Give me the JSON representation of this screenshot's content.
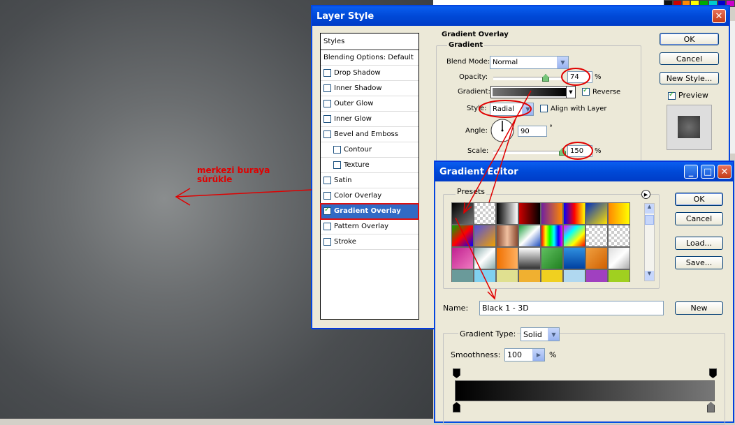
{
  "annotation": {
    "line1": "merkezi buraya",
    "line2": "sürükle"
  },
  "layer_style": {
    "title": "Layer Style",
    "styles_header": "Styles",
    "items": [
      {
        "label": "Blending Options: Default",
        "checkbox": false,
        "checked": false
      },
      {
        "label": "Drop Shadow",
        "checkbox": true,
        "checked": false
      },
      {
        "label": "Inner Shadow",
        "checkbox": true,
        "checked": false
      },
      {
        "label": "Outer Glow",
        "checkbox": true,
        "checked": false
      },
      {
        "label": "Inner Glow",
        "checkbox": true,
        "checked": false
      },
      {
        "label": "Bevel and Emboss",
        "checkbox": true,
        "checked": false
      },
      {
        "label": "Contour",
        "checkbox": true,
        "checked": false
      },
      {
        "label": "Texture",
        "checkbox": true,
        "checked": false
      },
      {
        "label": "Satin",
        "checkbox": true,
        "checked": false
      },
      {
        "label": "Color Overlay",
        "checkbox": true,
        "checked": false
      },
      {
        "label": "Gradient Overlay",
        "checkbox": true,
        "checked": true
      },
      {
        "label": "Pattern Overlay",
        "checkbox": true,
        "checked": false
      },
      {
        "label": "Stroke",
        "checkbox": true,
        "checked": false
      }
    ],
    "section_title": "Gradient Overlay",
    "group_title": "Gradient",
    "blend_mode_label": "Blend Mode:",
    "blend_mode_value": "Normal",
    "opacity_label": "Opacity:",
    "opacity_value": "74",
    "opacity_level": 0.74,
    "percent": "%",
    "gradient_label": "Gradient:",
    "reverse_label": "Reverse",
    "style_label": "Style:",
    "style_value": "Radial",
    "align_label": "Align with Layer",
    "angle_label": "Angle:",
    "angle_value": "90",
    "degree": "°",
    "scale_label": "Scale:",
    "scale_value": "150",
    "buttons": {
      "ok": "OK",
      "cancel": "Cancel",
      "new_style": "New Style..."
    },
    "preview_label": "Preview"
  },
  "gradient_editor": {
    "title": "Gradient Editor",
    "presets_label": "Presets",
    "name_label": "Name:",
    "name_value": "Black 1 - 3D",
    "new_button": "New",
    "buttons": {
      "ok": "OK",
      "cancel": "Cancel",
      "load": "Load...",
      "save": "Save..."
    },
    "type_label": "Gradient Type:",
    "type_value": "Solid",
    "smoothness_label": "Smoothness:",
    "smoothness_value": "100",
    "smoothness_unit": "%"
  },
  "colors": {
    "accent": "#316ac5",
    "titlebar": "#0049d7",
    "annotation": "#e00000"
  }
}
